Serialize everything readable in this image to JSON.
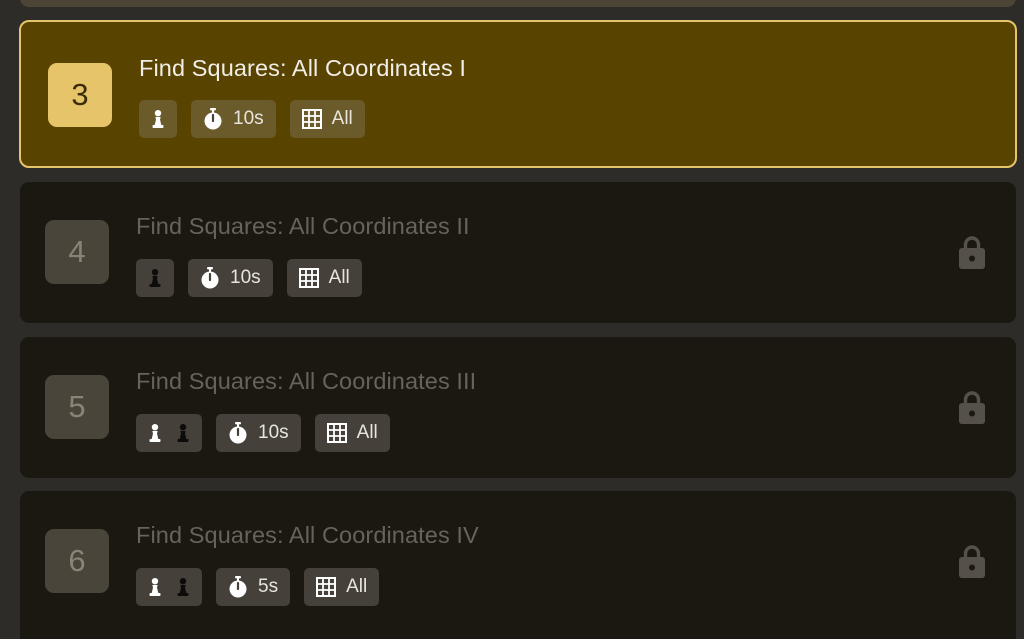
{
  "lessons": [
    {
      "number": "3",
      "title": "Find Squares: All Coordinates I",
      "time": "10s",
      "squares": "All",
      "pieces": [
        "white-pawn"
      ],
      "locked": false,
      "selected": true
    },
    {
      "number": "4",
      "title": "Find Squares: All Coordinates II",
      "time": "10s",
      "squares": "All",
      "pieces": [
        "black-pawn"
      ],
      "locked": true,
      "selected": false
    },
    {
      "number": "5",
      "title": "Find Squares: All Coordinates III",
      "time": "10s",
      "squares": "All",
      "pieces": [
        "white-pawn",
        "black-pawn"
      ],
      "locked": true,
      "selected": false
    },
    {
      "number": "6",
      "title": "Find Squares: All Coordinates IV",
      "time": "5s",
      "squares": "All",
      "pieces": [
        "white-pawn",
        "black-pawn"
      ],
      "locked": true,
      "selected": false
    }
  ],
  "icons": {
    "timer": "stopwatch-icon",
    "board": "grid-icon",
    "lock": "lock-icon"
  },
  "colors": {
    "selected_bg": "#584400",
    "selected_border": "#e6c46a",
    "locked_bg": "#1b1812",
    "badge_bg": "#45413a"
  }
}
